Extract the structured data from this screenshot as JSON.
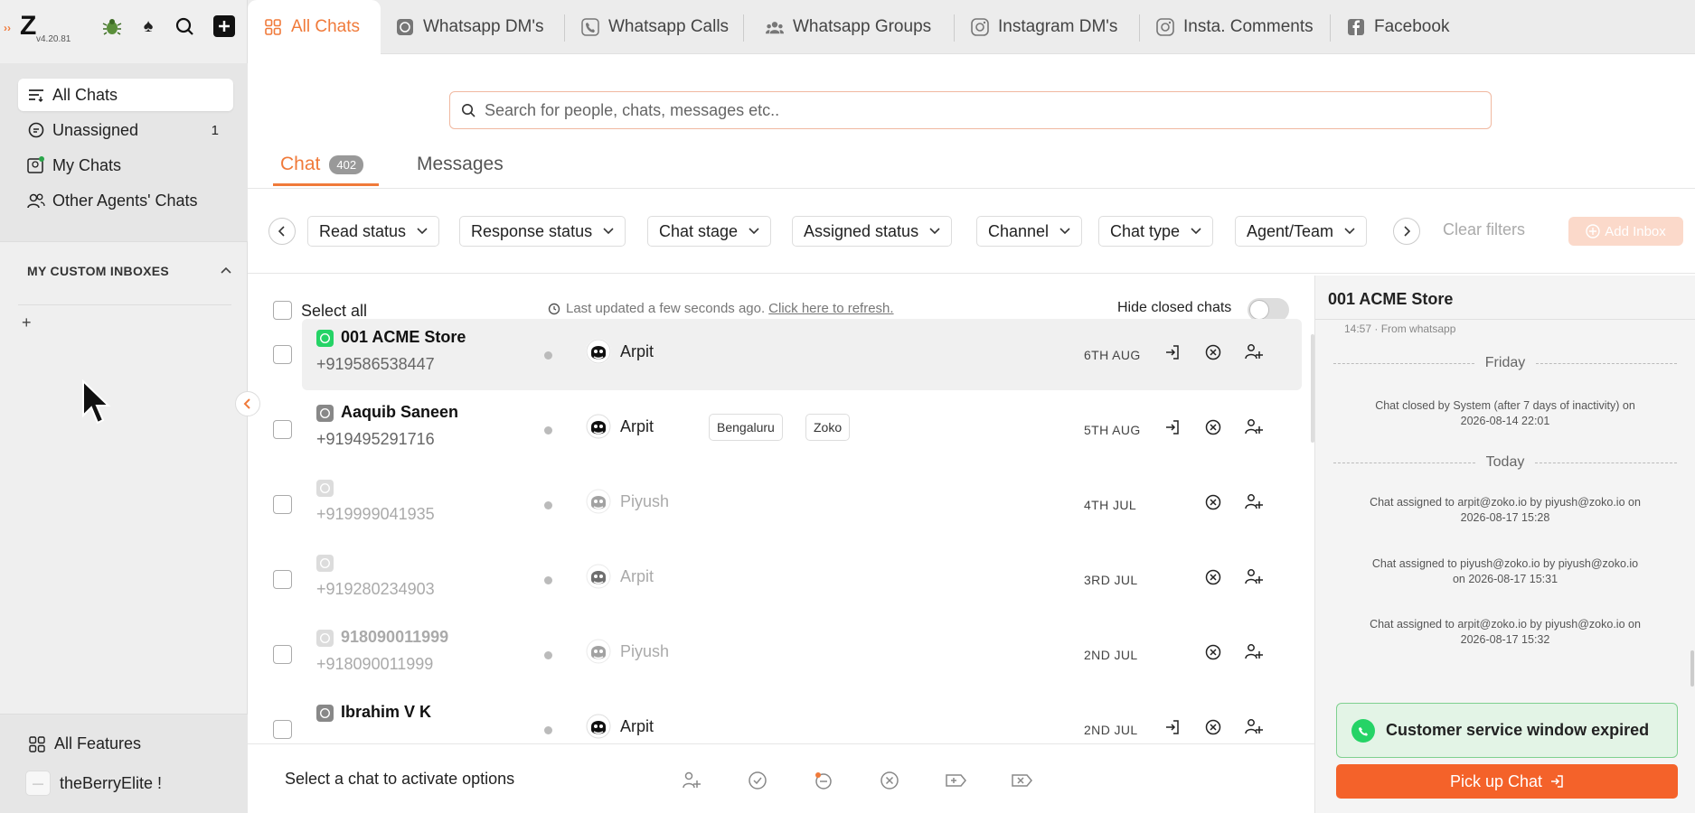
{
  "app": {
    "version": "v4.20.81",
    "logo_letter": "Z"
  },
  "sidebar": {
    "nav": [
      {
        "label": "All Chats",
        "icon": "filter-list-icon"
      },
      {
        "label": "Unassigned",
        "icon": "chat-bubble-icon",
        "count": "1"
      },
      {
        "label": "My Chats",
        "icon": "my-chats-icon"
      },
      {
        "label": "Other Agents' Chats",
        "icon": "users-icon"
      }
    ],
    "custom_header": "MY CUSTOM INBOXES",
    "all_features": "All Features",
    "user": "theBerryElite !"
  },
  "tabs": [
    {
      "label": "All Chats",
      "icon": "grid-icon"
    },
    {
      "label": "Whatsapp DM's",
      "icon": "whatsapp-icon"
    },
    {
      "label": "Whatsapp Calls",
      "icon": "phone-icon"
    },
    {
      "label": "Whatsapp Groups",
      "icon": "group-icon"
    },
    {
      "label": "Instagram DM's",
      "icon": "instagram-icon"
    },
    {
      "label": "Insta. Comments",
      "icon": "instagram-icon"
    },
    {
      "label": "Facebook",
      "icon": "facebook-icon"
    }
  ],
  "search": {
    "placeholder": "Search for people, chats, messages etc.."
  },
  "subtabs": {
    "chat": "Chat",
    "chat_count": "402",
    "messages": "Messages"
  },
  "filters": [
    "Read status",
    "Response status",
    "Chat stage",
    "Assigned status",
    "Channel",
    "Chat type",
    "Agent/Team"
  ],
  "clear_filters": "Clear filters",
  "add_inbox": "Add Inbox",
  "list": {
    "select_all": "Select all",
    "last_updated": "Last updated a few seconds ago.",
    "refresh": "Click here to refresh.",
    "hide_closed": "Hide closed chats"
  },
  "chats": [
    {
      "name": "001 ACME Store",
      "phone": "+919586538447",
      "agent": "Arpit",
      "date": "6TH AUG",
      "tags": [],
      "active": true
    },
    {
      "name": "Aaquib Saneen",
      "phone": "+919495291716",
      "agent": "Arpit",
      "date": "5TH AUG",
      "tags": [
        "Bengaluru",
        "Zoko"
      ],
      "active": true
    },
    {
      "name": "",
      "phone": "+919999041935",
      "agent": "Piyush",
      "date": "4TH JUL",
      "tags": [],
      "active": false
    },
    {
      "name": "",
      "phone": "+919280234903",
      "agent": "Arpit",
      "date": "3RD JUL",
      "tags": [],
      "active": false
    },
    {
      "name": "918090011999",
      "phone": "+918090011999",
      "agent": "Piyush",
      "date": "2ND JUL",
      "tags": [],
      "active": false
    },
    {
      "name": "Ibrahim V K",
      "phone": "",
      "agent": "Arpit",
      "date": "2ND JUL",
      "tags": [],
      "active": true
    }
  ],
  "bottombar": {
    "text": "Select a chat to activate options"
  },
  "panel": {
    "title": "001 ACME Store",
    "sub": "14:57 · From whatsapp",
    "day1": "Friday",
    "msg1": "Chat closed by System (after 7 days of inactivity) on 2026-08-14 22:01",
    "day2": "Today",
    "msg2": "Chat assigned to arpit@zoko.io by piyush@zoko.io on 2026-08-17 15:28",
    "msg3": "Chat assigned to piyush@zoko.io by piyush@zoko.io on 2026-08-17 15:31",
    "msg4": "Chat assigned to arpit@zoko.io by piyush@zoko.io on 2026-08-17 15:32",
    "window_expired": "Customer service window expired",
    "pickup": "Pick up Chat"
  },
  "colors": {
    "accent": "#f07a3a",
    "whatsapp": "#25d366",
    "pickup": "#f4622a"
  }
}
